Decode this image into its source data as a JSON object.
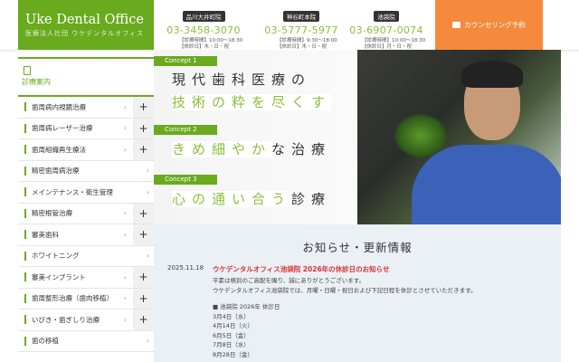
{
  "logo": {
    "name": "Uke Dental Office",
    "subtitle": "医療法人社団 ウケデンタルオフィス"
  },
  "clinics": [
    {
      "name": "品川大井町院",
      "tel": "03-3458-3070",
      "hours": "【診療時間】10:00～18:30",
      "closed": "【休診日】木・日・祝"
    },
    {
      "name": "神谷町本院",
      "tel": "03-5777-5977",
      "hours": "【診療時間】9:30～18:00",
      "closed": "【休診日】木・日・祝"
    },
    {
      "name": "池袋院",
      "tel": "03-6907-0074",
      "hours": "【診療時間】10:00～18:30",
      "closed": "【休診日】月・日・祝"
    }
  ],
  "cta": {
    "label": "カウンセリング予約"
  },
  "sidebar": {
    "heading": "診療案内",
    "items": [
      {
        "label": "歯周病内視鏡治療",
        "plus": true
      },
      {
        "label": "歯周病レーザー治療",
        "plus": true
      },
      {
        "label": "歯周組織再生療法",
        "plus": true
      },
      {
        "label": "精密歯周病治療",
        "plus": false
      },
      {
        "label": "メインテナンス・衛生管理",
        "plus": false
      },
      {
        "label": "精密根管治療",
        "plus": true
      },
      {
        "label": "審美歯科",
        "plus": true
      },
      {
        "label": "ホワイトニング",
        "plus": false
      },
      {
        "label": "審美インプラント",
        "plus": true
      },
      {
        "label": "歯周整形治療（歯肉移植）",
        "plus": true
      },
      {
        "label": "いびき・歯ぎしり治療",
        "plus": true
      },
      {
        "label": "歯の移植",
        "plus": false
      }
    ]
  },
  "concepts": [
    {
      "tag": "Concept 1",
      "line1": "現代歯科医療の",
      "line2": "技術の粋を尽くす"
    },
    {
      "tag": "Concept 2",
      "green": "きめ細やか",
      "rest": "な治療"
    },
    {
      "tag": "Concept 3",
      "green": "心の通い合う",
      "rest": "診療"
    }
  ],
  "news": {
    "heading": "お知らせ・更新情報",
    "date": "2025.11.18",
    "title": "ウケデンタルオフィス池袋院 2026年の休診日のお知らせ",
    "body": [
      "平素は格別のご高配を賜り、誠にありがとうございます。",
      "ウケデンタルオフィス池袋院では、月曜・日曜・祝日および下記日程を休診とさせていただきます。"
    ],
    "list_heading": "■ 池袋院 2026年 休診日",
    "dates": [
      "3月4日（水）",
      "4月14日（火）",
      "6月5日（金）",
      "7月8日（水）",
      "8月28日（金）"
    ]
  }
}
